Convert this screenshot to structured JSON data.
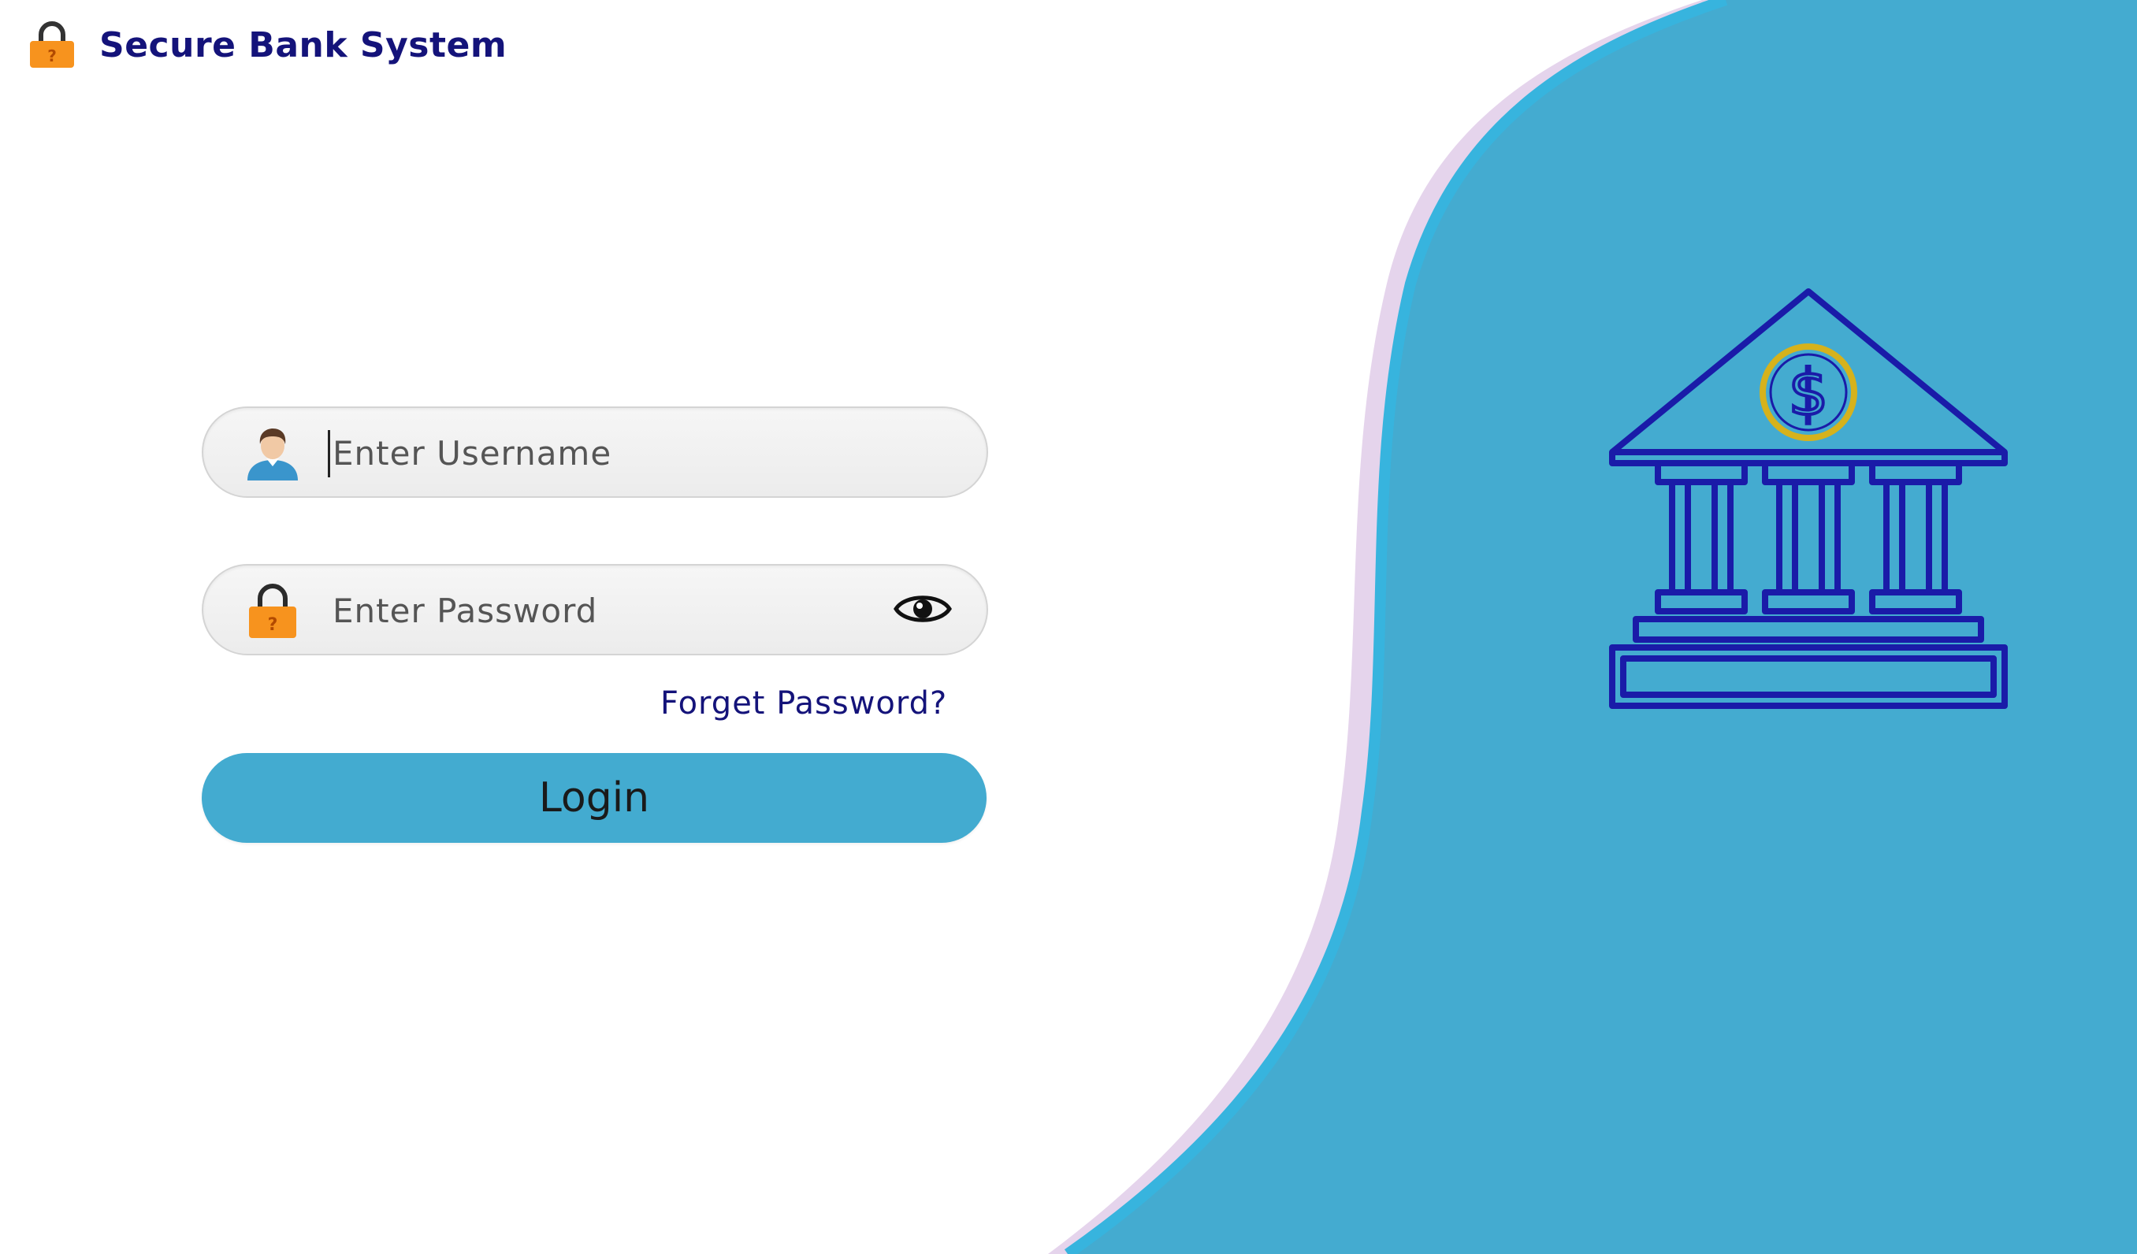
{
  "header": {
    "title": "Secure Bank System",
    "icon": "lock-icon"
  },
  "form": {
    "username": {
      "placeholder": "Enter Username",
      "value": "",
      "icon": "user-avatar-icon"
    },
    "password": {
      "placeholder": "Enter Password",
      "value": "",
      "icon": "lock-icon",
      "toggle_icon": "eye-icon"
    },
    "forgot_password_label": "Forget Password?",
    "login_label": "Login"
  },
  "illustration": {
    "icon": "bank-building-icon"
  },
  "colors": {
    "accent": "#43abd0",
    "title": "#14137a",
    "lock": "#f7931e",
    "bank_outline": "#1a1ba8",
    "coin": "#d6b21c"
  }
}
